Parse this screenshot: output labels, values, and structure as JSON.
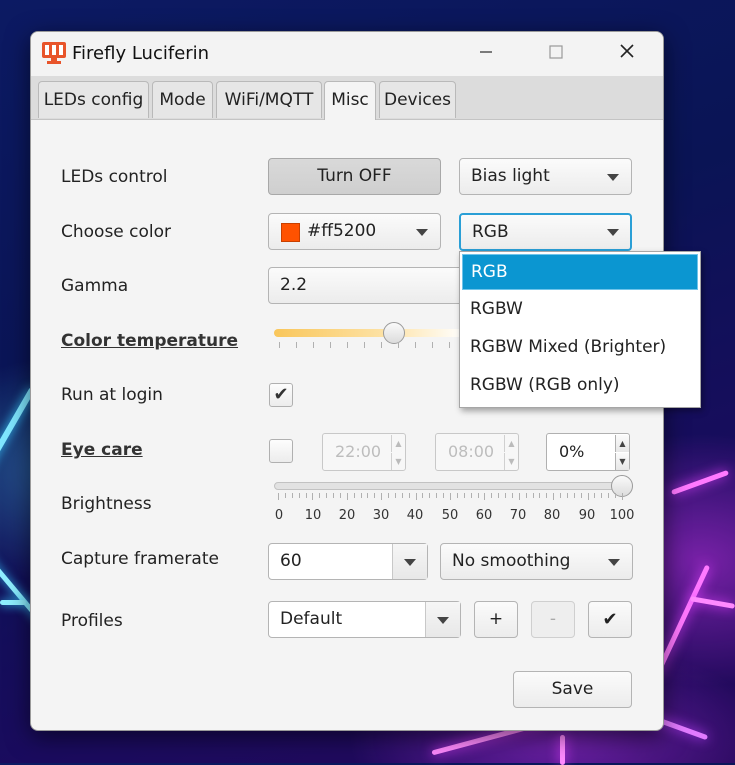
{
  "window": {
    "title": "Firefly Luciferin",
    "controls": [
      "minimize-icon",
      "maximize-icon",
      "close-icon"
    ]
  },
  "tabs": [
    {
      "label": "LEDs config",
      "active": false
    },
    {
      "label": "Mode",
      "active": false
    },
    {
      "label": "WiFi/MQTT",
      "active": false
    },
    {
      "label": "Misc",
      "active": true
    },
    {
      "label": "Devices",
      "active": false
    }
  ],
  "leds_control": {
    "label": "LEDs control",
    "button": "Turn OFF",
    "mode_selected": "Bias light"
  },
  "choose_color": {
    "label": "Choose color",
    "color_hex": "#ff5200",
    "color_text": "#ff5200",
    "format_selected": "RGB"
  },
  "gamma": {
    "label": "Gamma",
    "value": "2.2"
  },
  "color_temperature": {
    "label": "Color temperature"
  },
  "run_at_login": {
    "label": "Run at login",
    "checked": true
  },
  "eye_care": {
    "label": "Eye care",
    "checked": false,
    "start": "22:00",
    "end": "08:00",
    "percent": "0%"
  },
  "brightness": {
    "label": "Brightness",
    "value": 100,
    "ticks": [
      "0",
      "10",
      "20",
      "30",
      "40",
      "50",
      "60",
      "70",
      "80",
      "90",
      "100"
    ]
  },
  "capture_framerate": {
    "label": "Capture framerate",
    "value": "60",
    "smoothing": "No smoothing"
  },
  "profiles": {
    "label": "Profiles",
    "value": "Default",
    "add": "+",
    "remove": "-",
    "apply": "✔"
  },
  "save_button": "Save",
  "format_dropdown": {
    "options": [
      "RGB",
      "RGBW",
      "RGBW Mixed (Brighter)",
      "RGBW (RGB only)"
    ],
    "selected": "RGB"
  },
  "colors": {
    "accent": "#0b96d1",
    "focus": "#2a9fd6",
    "swatch": "#ff5200"
  }
}
